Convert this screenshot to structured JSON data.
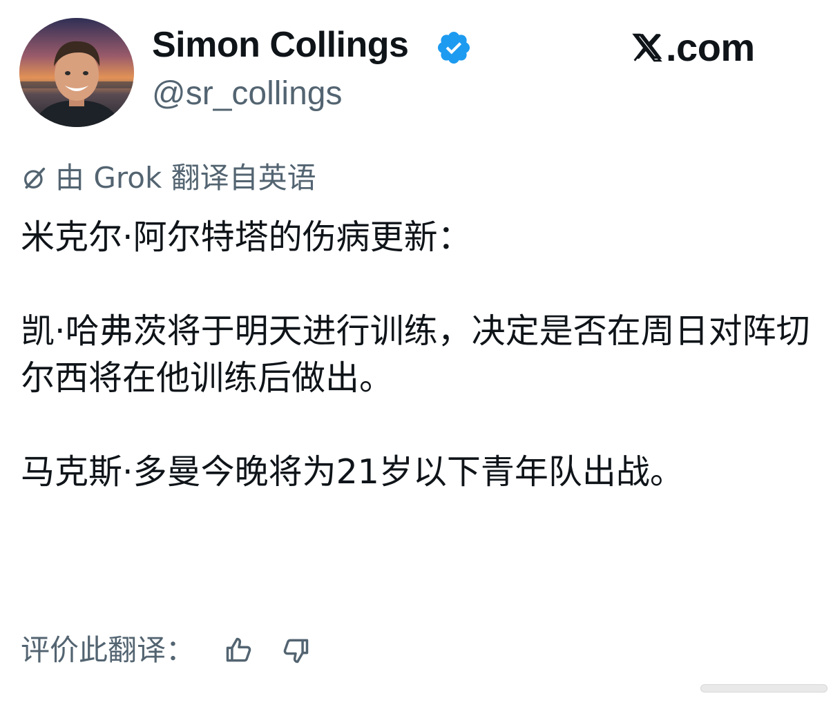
{
  "author": {
    "display_name": "Simon Collings",
    "handle": "@sr_collings",
    "verified": true,
    "avatar_icon": "profile-photo"
  },
  "brand": {
    "text": ".com",
    "logo_icon": "x-logo-icon"
  },
  "translation": {
    "icon": "grok-icon",
    "label": "由 Grok 翻译自英语"
  },
  "tweet": {
    "line1": "米克尔·阿尔特塔的伤病更新：",
    "paragraph2": "凯·哈弗茨将于明天进行训练，决定是否在周日对阵切尔西将在他训练后做出。",
    "paragraph3": "马克斯·多曼今晚将为21岁以下青年队出战。"
  },
  "rating": {
    "label": "评价此翻译：",
    "like_icon": "thumbs-up-icon",
    "dislike_icon": "thumbs-down-icon"
  },
  "colors": {
    "text_primary": "#0f1419",
    "text_secondary": "#536471",
    "verified_blue": "#1d9bf0"
  }
}
